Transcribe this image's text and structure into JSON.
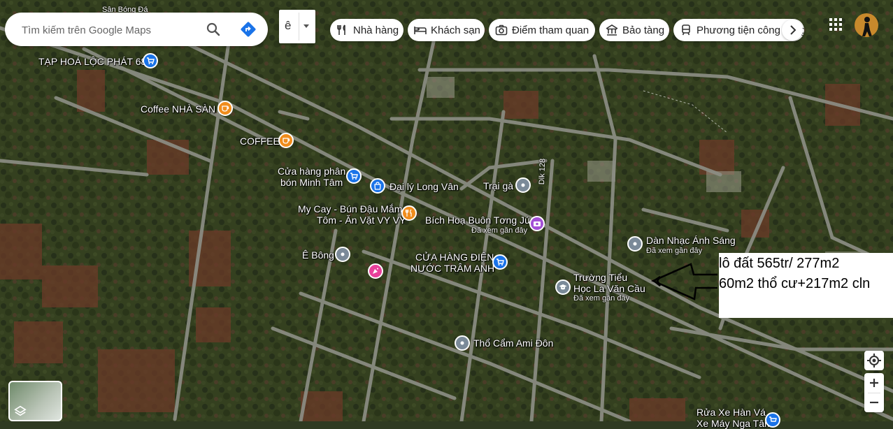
{
  "search": {
    "placeholder": "Tìm kiếm trên Google Maps"
  },
  "layer": {
    "label": "ê"
  },
  "chips": [
    {
      "label": "Nhà hàng",
      "icon": "fork-knife-icon"
    },
    {
      "label": "Khách sạn",
      "icon": "bed-icon"
    },
    {
      "label": "Điểm tham quan",
      "icon": "camera-icon"
    },
    {
      "label": "Bảo tàng",
      "icon": "museum-icon"
    },
    {
      "label": "Phương tiện công cộng",
      "icon": "transit-icon"
    }
  ],
  "places": [
    {
      "name": "TẠP HOÁ LỘC PHÁT 68",
      "icon": "shopping-cart-icon",
      "color": "#1a73e8"
    },
    {
      "name": "Coffee NHÀ SÀN",
      "icon": "coffee-icon",
      "color": "#f08c1c"
    },
    {
      "name": "COFFEE",
      "icon": "coffee-icon",
      "color": "#f08c1c"
    },
    {
      "name_line1": "Cửa hàng phân",
      "name_line2": "bón Minh Tâm",
      "icon": "shopping-cart-icon",
      "color": "#1a73e8"
    },
    {
      "name": "Đại lý Long Vân",
      "icon": "shopping-bag-icon",
      "color": "#1a73e8"
    },
    {
      "name": "Trại gà",
      "icon": "pin-icon",
      "color": "#7b8a99"
    },
    {
      "name_line1": "My Cay - Bún Đậu Mắm",
      "name_line2": "Tôm - Ăn Vặt VY VY",
      "icon": "restaurant-icon",
      "color": "#f08c1c"
    },
    {
      "name": "Bích Hoạ Buôn Tơng Jú",
      "sub": "Đã xem gần đây",
      "icon": "camera-icon",
      "color": "#a350d6"
    },
    {
      "name": "Dàn Nhạc Ánh Sáng",
      "sub": "Đã xem gần đây",
      "icon": "pin-icon",
      "color": "#7b8a99"
    },
    {
      "name": "Ê Bông",
      "icon": "pin-icon",
      "color": "#7b8a99"
    },
    {
      "name": "",
      "icon": "celebration-icon",
      "color": "#e8409a"
    },
    {
      "name_line1": "CỬA HÀNG ĐIỆN",
      "name_line2": "NƯỚC TRÂM ANH",
      "icon": "shopping-cart-icon",
      "color": "#1a73e8"
    },
    {
      "name_line1": "Trường Tiểu",
      "name_line2": "Học La Văn Cầu",
      "sub": "Đã xem gần đây",
      "icon": "school-icon",
      "color": "#7b8a99"
    },
    {
      "name": "Thổ Cẩm Ami Đôn",
      "icon": "pin-icon",
      "color": "#7b8a99"
    },
    {
      "name_line1": "Rửa Xe Hàn Vá,",
      "name_line2": "Xe Máy Nga Tâm",
      "icon": "shopping-cart-icon",
      "color": "#1a73e8"
    }
  ],
  "roads": {
    "dlk128": "Dlk 128",
    "top": "Sân Bóng Đá"
  },
  "annotation": {
    "line1": "lô đất 565tr/ 277m2",
    "line2": "60m2 thổ cư+217m2 cln"
  },
  "colors": {
    "accent": "#1a73e8"
  }
}
